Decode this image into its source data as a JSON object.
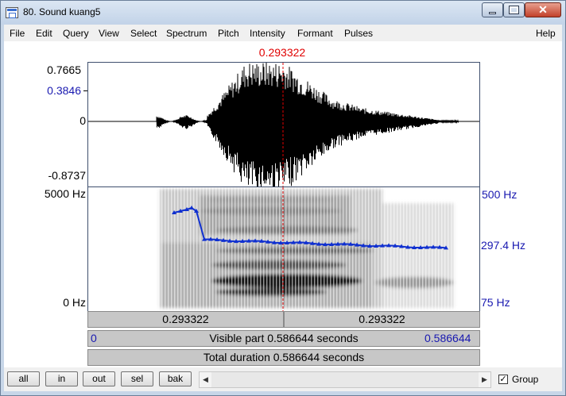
{
  "window": {
    "title": "80. Sound kuang5",
    "close_glyph": "✕"
  },
  "menu": [
    "File",
    "Edit",
    "Query",
    "View",
    "Select",
    "Spectrum",
    "Pitch",
    "Intensity",
    "Formant",
    "Pulses"
  ],
  "menu_help": "Help",
  "cursor": {
    "time_label": "0.293322",
    "time": 0.293322,
    "color": "#e00000"
  },
  "waveform": {
    "y_max": "0.7665",
    "y_cursor": "0.3846",
    "y_zero": "0",
    "y_min": "-0.8737"
  },
  "spectrogram": {
    "freq_max": "5000 Hz",
    "freq_min": "0 Hz",
    "pitch_max": "500 Hz",
    "pitch_value": "297.4 Hz",
    "pitch_min": "75 Hz",
    "pitch_color": "#1030d0"
  },
  "time_axis": {
    "left_part": "0.293322",
    "right_part": "0.293322",
    "visible_start": "0",
    "visible_label": "Visible part 0.586644 seconds",
    "visible_end": "0.586644",
    "total_label": "Total duration 0.586644 seconds"
  },
  "buttons": {
    "all": "all",
    "in": "in",
    "out": "out",
    "sel": "sel",
    "bak": "bak"
  },
  "group": {
    "label": "Group",
    "checked": true,
    "check_glyph": "✓"
  },
  "scroll_glyphs": {
    "left": "◀",
    "right": "▶"
  }
}
